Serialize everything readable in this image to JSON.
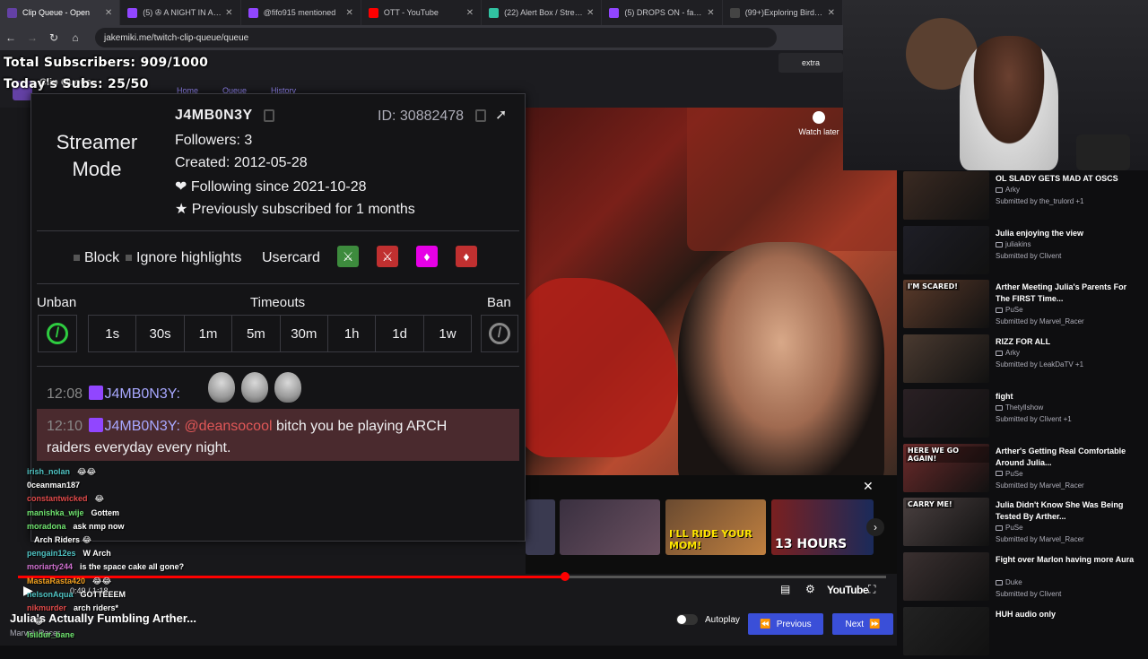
{
  "browser": {
    "tabs": [
      {
        "label": "Clip Queue - Open",
        "color": "#6441a5",
        "active": true
      },
      {
        "label": "(5) ✇ A NIGHT IN AMST",
        "color": "#9146ff"
      },
      {
        "label": "@fifo915 mentioned",
        "color": "#9146ff"
      },
      {
        "label": "OTT - YouTube",
        "color": "#ff0000"
      },
      {
        "label": "(22) Alert Box / Streamlab",
        "color": "#31c3a2"
      },
      {
        "label": "(5) DROPS ON - fat - Twi",
        "color": "#9146ff"
      },
      {
        "label": "(99+)Exploring Bird The",
        "color": "#444"
      }
    ],
    "url": "jakemiki.me/twitch-clip-queue/queue"
  },
  "site": {
    "nav": [
      "Home",
      "Queue",
      "History"
    ],
    "extra_button": "extra",
    "brand_label": "Clip Queue"
  },
  "overlay_stats": {
    "total_subs": "Total Subscribers: 909/1000",
    "today_subs": "Today's Subs: 25/50"
  },
  "usercard": {
    "streamer_mode": "Streamer Mode",
    "username": "J4MB0N3Y",
    "id_label": "ID: 30882478",
    "followers": "Followers: 3",
    "created": "Created: 2012-05-28",
    "following": "❤ Following since 2021-10-28",
    "subscribed": "★ Previously subscribed for 1 months",
    "options": {
      "block": "Block",
      "ignore": "Ignore highlights",
      "usercard": "Usercard"
    },
    "mod_icon_colors": [
      "#3d8b3d",
      "#c03030",
      "#e600e6",
      "#c03030"
    ],
    "unban_label": "Unban",
    "timeouts_label": "Timeouts",
    "ban_label": "Ban",
    "timeouts": [
      "1s",
      "30s",
      "1m",
      "5m",
      "30m",
      "1h",
      "1d",
      "1w"
    ],
    "messages": [
      {
        "time": "12:08",
        "user": "J4MB0N3Y:",
        "text": ""
      },
      {
        "time": "12:10",
        "user": "J4MB0N3Y:",
        "mention": "@deansocool",
        "text": " bitch you be playing ARCH",
        "text2": "raiders everyday every night."
      }
    ]
  },
  "video": {
    "watch_later": "Watch later",
    "time": "0:49 / 1:18",
    "progress": 0.63,
    "youtube_label": "YouTube",
    "related": [
      {
        "caption": ""
      },
      {
        "caption": ""
      },
      {
        "caption": "I'LL RIDE YOUR MOM!"
      },
      {
        "caption": "13 HOURS"
      }
    ]
  },
  "current_clip": {
    "title": "Julia's Actually Fumbling Arther...",
    "meta": "Marvel_Racer"
  },
  "controls": {
    "autoplay": "Autoplay",
    "previous": "Previous",
    "next": "Next"
  },
  "queue": [
    {
      "title": "OL SLADY GETS MAD AT OSCS",
      "channel": "Arky",
      "submitted": "Submitted by the_trulord +1",
      "thumb": "#3a2a22",
      "cap": ""
    },
    {
      "title": "Julia enjoying the view",
      "channel": "juliakins",
      "submitted": "Submitted by Clivent",
      "thumb": "#1e1e26",
      "cap": ""
    },
    {
      "title": "Arther Meeting Julia's Parents For The FIRST Time...",
      "channel": "PuSe",
      "submitted": "Submitted by Marvel_Racer",
      "thumb": "#5a3a2a",
      "cap": "I'M SCARED!"
    },
    {
      "title": "RIZZ FOR ALL",
      "channel": "Arky",
      "submitted": "Submitted by LeakDaTV +1",
      "thumb": "#4a3a30",
      "cap": ""
    },
    {
      "title": "fight",
      "channel": "Thetyllshow",
      "submitted": "Submitted by Clivent +1",
      "thumb": "#2a2024",
      "cap": ""
    },
    {
      "title": "Arther's Getting Real Comfortable Around Julia...",
      "channel": "PuSe",
      "submitted": "Submitted by Marvel_Racer",
      "thumb": "#6a2a2a",
      "cap": "HERE WE GO AGAIN!"
    },
    {
      "title": "Julia Didn't Know She Was Being Tested By Arther...",
      "channel": "PuSe",
      "submitted": "Submitted by Marvel_Racer",
      "thumb": "#4a4040",
      "cap": "CARRY ME!"
    },
    {
      "title": "Fight over Marlon having more Aura",
      "channel": "Duke",
      "submitted": "Submitted by Clivent",
      "thumb": "#3a3030",
      "cap": ""
    },
    {
      "title": "HUH audio only",
      "channel": "",
      "submitted": "",
      "thumb": "#222",
      "cap": ""
    }
  ],
  "overlay_chat": [
    {
      "name": "irish_nolan",
      "color": "#4fc3c3",
      "msg": "😂😂"
    },
    {
      "name": "0ceanman187",
      "color": "#ffffff",
      "msg": ""
    },
    {
      "name": "constantwicked",
      "color": "#e04a4a",
      "msg": "😂"
    },
    {
      "name": "manishka_wije",
      "color": "#6fe36f",
      "msg": "Gottem"
    },
    {
      "name": "moradona",
      "color": "#6fe36f",
      "msg": "ask nmp now"
    },
    {
      "name": "",
      "color": "#ffffff",
      "msg": "Arch Riders 😂"
    },
    {
      "name": "pengain12es",
      "color": "#4fc3c3",
      "msg": "W Arch"
    },
    {
      "name": "moriarty244",
      "color": "#d070d0",
      "msg": "is the space cake all gone?"
    },
    {
      "name": "MastaRasta420",
      "color": "#f0a020",
      "msg": "😂😂"
    },
    {
      "name": "nelsonAqua",
      "color": "#4fc3c3",
      "msg": "GOTTEEEM"
    },
    {
      "name": "nikmurder",
      "color": "#e04a4a",
      "msg": "arch riders*"
    },
    {
      "name": "",
      "color": "#ffffff",
      "msg": "😂"
    },
    {
      "name": "Isildur_bane",
      "color": "#6fe36f",
      "msg": ""
    }
  ]
}
